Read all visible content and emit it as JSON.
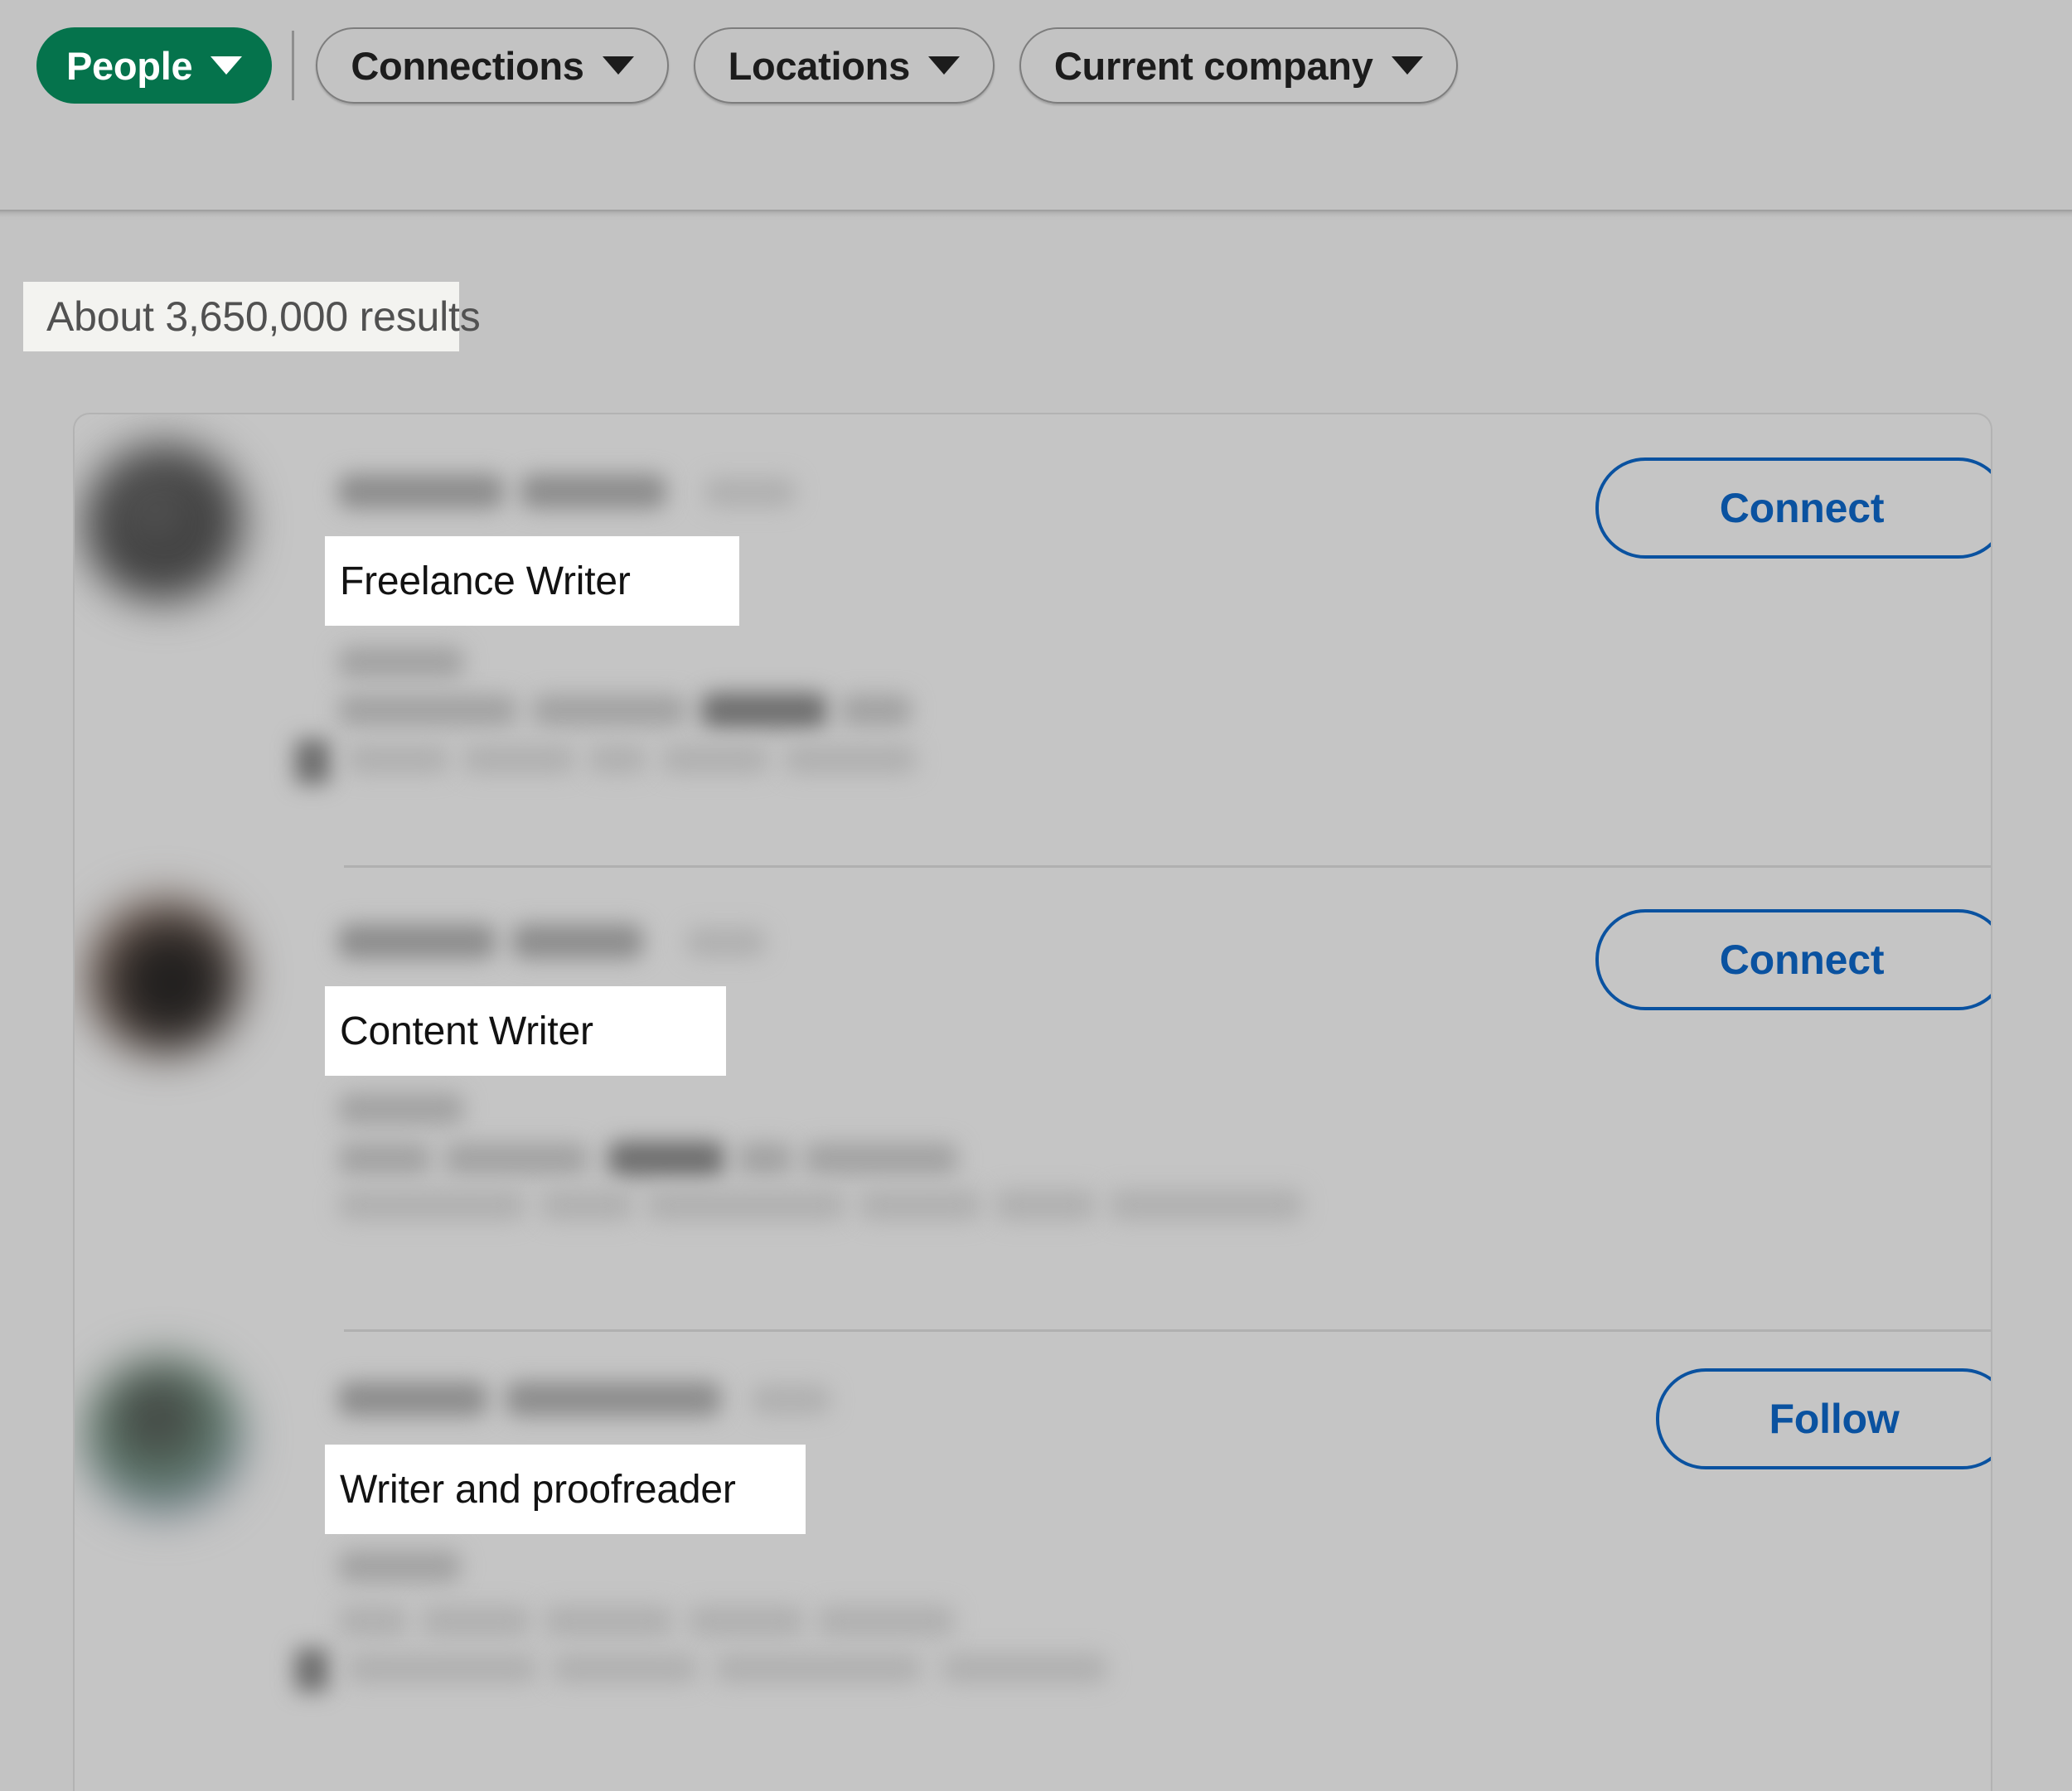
{
  "filter_bar": {
    "primary_filter": {
      "label": "People",
      "icon": "chevron-down-icon",
      "color": "#05734c"
    },
    "filters": [
      {
        "label": "Connections",
        "icon": "chevron-down-icon"
      },
      {
        "label": "Locations",
        "icon": "chevron-down-icon"
      },
      {
        "label": "Current company",
        "icon": "chevron-down-icon"
      }
    ]
  },
  "results": {
    "count_text": "About 3,650,000 results",
    "items": [
      {
        "headline": "Freelance Writer",
        "action_label": "Connect",
        "avatar": "avatar-blurred-1"
      },
      {
        "headline": "Content Writer",
        "action_label": "Connect",
        "avatar": "avatar-blurred-2"
      },
      {
        "headline": "Writer and proofreader",
        "action_label": "Follow",
        "avatar": "avatar-blurred-3"
      }
    ]
  },
  "colors": {
    "page_background": "#c3c3c3",
    "accent_green": "#05734c",
    "link_blue": "#0a52a0",
    "highlight_white": "#ffffff",
    "count_background": "#f3f3f0"
  }
}
